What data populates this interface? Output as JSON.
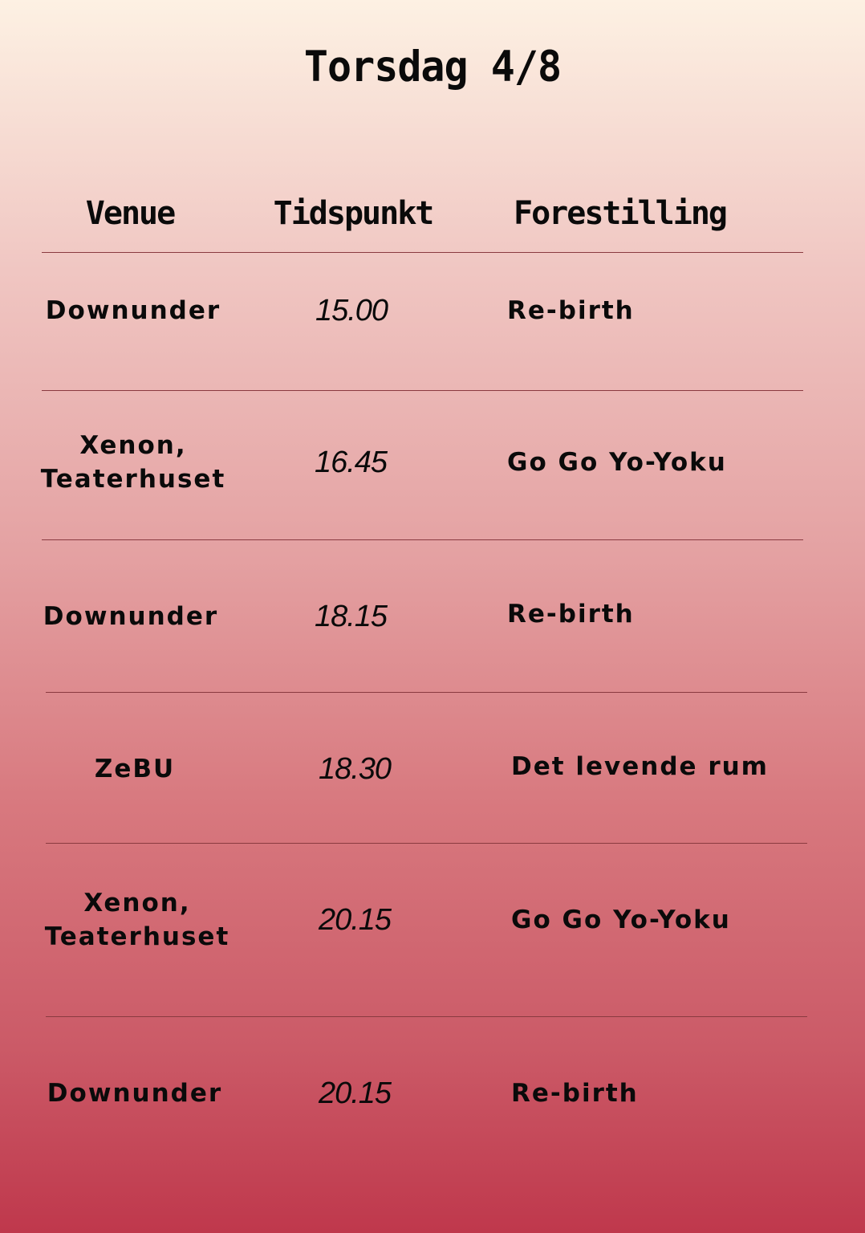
{
  "title": "Torsdag 4/8",
  "headers": {
    "venue": "Venue",
    "time": "Tidspunkt",
    "show": "Forestilling"
  },
  "rows": [
    {
      "venue": "Downunder",
      "time": "15.00",
      "show": "Re-birth"
    },
    {
      "venue": "Xenon, Teaterhuset",
      "time": "16.45",
      "show": "Go Go Yo-Yoku"
    },
    {
      "venue": "Downunder",
      "time": "18.15",
      "show": "Re-birth"
    },
    {
      "venue": "ZeBU",
      "time": "18.30",
      "show": "Det levende rum"
    },
    {
      "venue": "Xenon, Teaterhuset",
      "time": "20.15",
      "show": "Go Go Yo-Yoku"
    },
    {
      "venue": "Downunder",
      "time": "20.15",
      "show": "Re-birth"
    }
  ],
  "colors": {
    "gradient_top": "#fdf1e3",
    "gradient_bottom": "#bf384c",
    "rule": "#8a3a40"
  }
}
